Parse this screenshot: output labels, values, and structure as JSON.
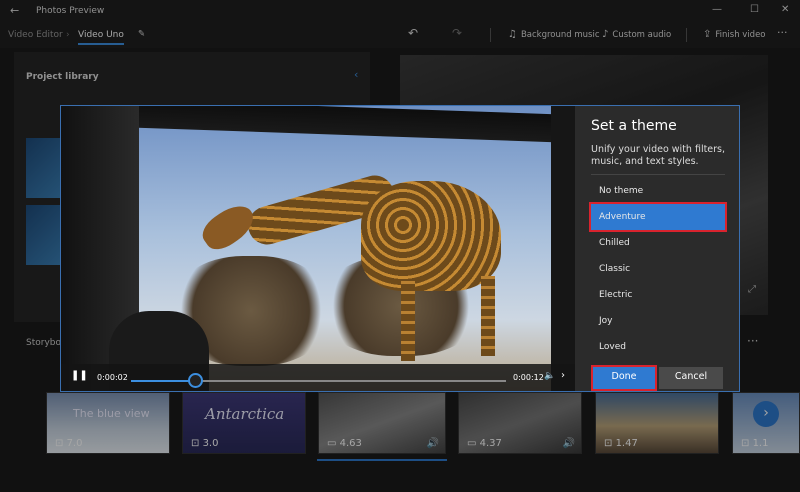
{
  "app": {
    "title": "Photos Preview"
  },
  "window_controls": {
    "minimize": "—",
    "maximize": "☐",
    "close": "✕"
  },
  "toolbar": {
    "crumb_parent": "Video Editor",
    "crumb_current": "Video Uno",
    "background_music": "Background music",
    "custom_audio": "Custom audio",
    "finish_video": "Finish video",
    "more": "···"
  },
  "library": {
    "title": "Project library"
  },
  "storyboard": {
    "label": "Storyboard",
    "items": [
      {
        "text": "The blue view",
        "duration": "7.0"
      },
      {
        "text": "Antarctica",
        "duration": "3.0"
      },
      {
        "text": "",
        "duration": "4.63"
      },
      {
        "text": "",
        "duration": "4.37"
      },
      {
        "text": "",
        "duration": "1.47"
      },
      {
        "text": "",
        "duration": "1.1"
      }
    ]
  },
  "player": {
    "current_time": "0:00:02",
    "total_time": "0:00:12",
    "progress": 0.17
  },
  "dialog": {
    "title": "Set a theme",
    "description": "Unify your video with filters, music, and text styles.",
    "themes": [
      "No theme",
      "Adventure",
      "Chilled",
      "Classic",
      "Electric",
      "Joy",
      "Loved"
    ],
    "selected_theme": "Adventure",
    "done": "Done",
    "cancel": "Cancel"
  },
  "colors": {
    "accent": "#2f7ad1",
    "highlight": "#d9232e"
  }
}
